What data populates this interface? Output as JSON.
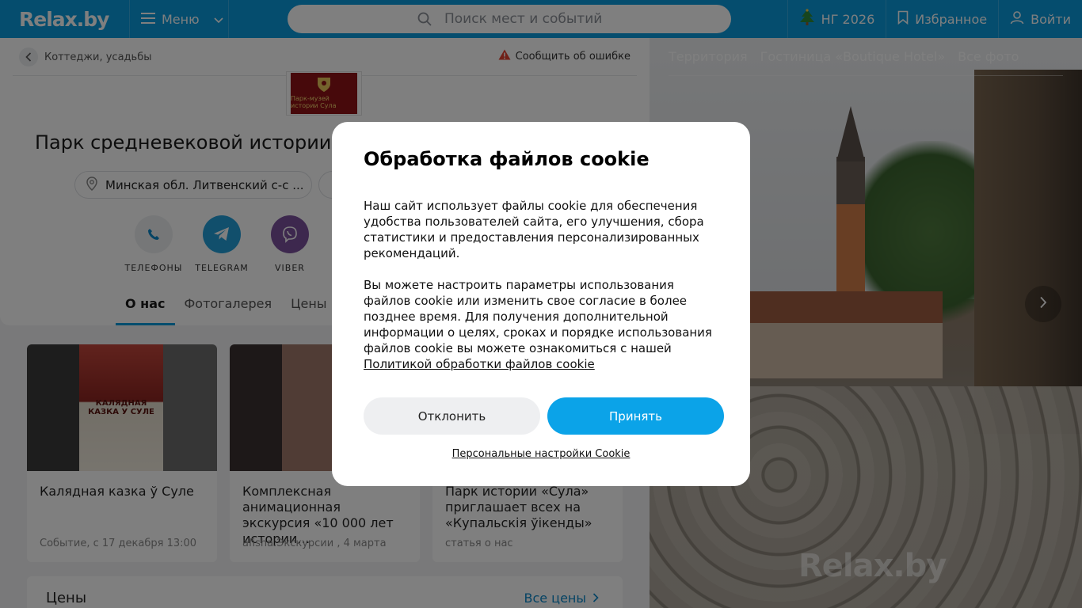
{
  "header": {
    "logo": "Relax.by",
    "menu_label": "Меню",
    "search_placeholder": "Поиск мест и событий",
    "ny_label": "НГ 2026",
    "favorites_label": "Избранное",
    "login_label": "Войти"
  },
  "breadcrumb": {
    "label": "Коттеджи, усадьбы"
  },
  "report_label": "Сообщить об ошибке",
  "org": {
    "logo_text": "Парк-музей истории Сула",
    "title": "Парк средневековой истории",
    "address": "Минская обл. Литвенский с-с ..."
  },
  "contacts": [
    {
      "label": "ТЕЛЕФОНЫ",
      "icon": "phone-icon"
    },
    {
      "label": "TELEGRAM",
      "icon": "telegram-icon"
    },
    {
      "label": "VIBER",
      "icon": "viber-icon"
    }
  ],
  "tabs": [
    {
      "label": "О нас",
      "active": true
    },
    {
      "label": "Фотогалерея",
      "active": false
    },
    {
      "label": "Цены",
      "active": false
    }
  ],
  "cards": [
    {
      "title": "Калядная казка ў Суле",
      "meta": "Событие, с 17 декабря 13:00",
      "poster_text": "КАЛЯДНАЯ КАЗКА У СУЛЕ"
    },
    {
      "title": "Комплексная анимационная экскурсия «10 000 лет истории…",
      "meta": "afisha.Экскурсии , 4 марта"
    },
    {
      "title": "Парк истории «Сула» приглашает всех на «Купальскія ўікенды»",
      "meta": "статья о нас"
    }
  ],
  "prices": {
    "title": "Цены",
    "link": "Все цены"
  },
  "photo": {
    "tabs": [
      "Территория",
      "Гостиница «Boutique Hotel»",
      "Все фото"
    ],
    "watermark": "Relax.by"
  },
  "cookie_modal": {
    "title": "Обработка файлов cookie",
    "paragraph1": "Наш сайт использует файлы cookie для обеспечения удобства пользователей сайта, его улучшения, сбора статистики и предоставления персонализированных рекомендаций.",
    "paragraph2": "Вы можете настроить параметры использования файлов cookie или изменить свое согласие в более позднее время. Для получения дополнительной информации о целях, сроках и порядке использования файлов cookie вы можете ознакомиться с нашей",
    "policy_link": "Политикой обработки файлов cookie",
    "decline_label": "Отклонить",
    "accept_label": "Принять",
    "settings_link": "Персональные настройки Cookie"
  },
  "colors": {
    "brand": "#0b9bdd",
    "accept_button": "#0ba3e8",
    "telegram": "#229ed9",
    "viber": "#7b519d"
  }
}
